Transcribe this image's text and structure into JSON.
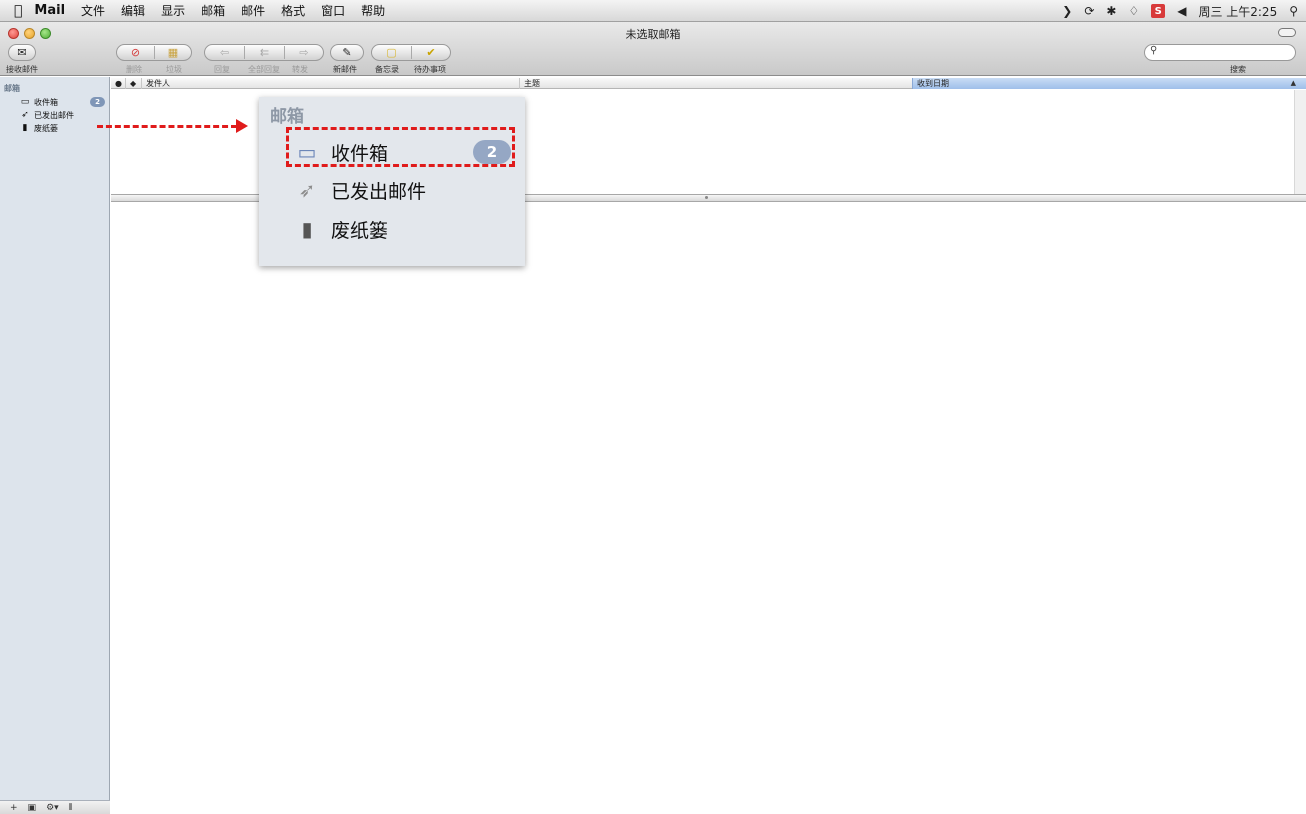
{
  "menubar": {
    "app_name": "Mail",
    "items": [
      "文件",
      "编辑",
      "显示",
      "邮箱",
      "邮件",
      "格式",
      "窗口",
      "帮助"
    ],
    "clock": "周三 上午2:25",
    "status_icons": [
      "bluetooth-icon",
      "wifi-icon",
      "volume-icon",
      "spotlight-icon"
    ],
    "status_badge": "S"
  },
  "window": {
    "title": "未选取邮箱"
  },
  "toolbar": {
    "get_mail": "接收邮件",
    "delete": "删除",
    "junk": "垃圾",
    "reply": "回复",
    "reply_all": "全部回复",
    "forward": "转发",
    "new_message": "新邮件",
    "note": "备忘录",
    "todo": "待办事项",
    "search_label": "搜索",
    "search_placeholder": ""
  },
  "sidebar": {
    "header": "邮箱",
    "items": [
      {
        "label": "收件箱",
        "icon": "inbox-icon",
        "badge": "2"
      },
      {
        "label": "已发出邮件",
        "icon": "sent-icon"
      },
      {
        "label": "废纸篓",
        "icon": "trash-icon"
      }
    ]
  },
  "message_list": {
    "columns": [
      "发件人",
      "主题",
      "收到日期"
    ],
    "sort_indicator": "▲"
  },
  "callout": {
    "title": "邮箱",
    "items": [
      {
        "label": "收件箱",
        "badge": "2"
      },
      {
        "label": "已发出邮件"
      },
      {
        "label": "废纸篓"
      }
    ]
  },
  "colors": {
    "highlight": "#e01b1b",
    "sidebar_bg": "#dde4ec",
    "badge": "#7f96b7"
  }
}
